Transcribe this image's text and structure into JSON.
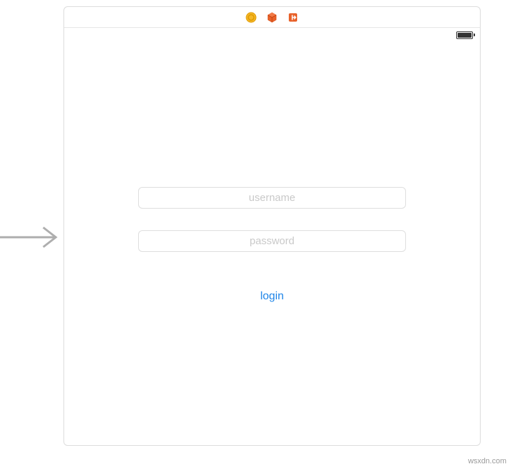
{
  "toolbar": {
    "icons": [
      "coin-icon",
      "cube-icon",
      "logout-icon"
    ]
  },
  "form": {
    "username_placeholder": "username",
    "password_placeholder": "password",
    "login_label": "login"
  },
  "watermark": "wsxdn.com"
}
